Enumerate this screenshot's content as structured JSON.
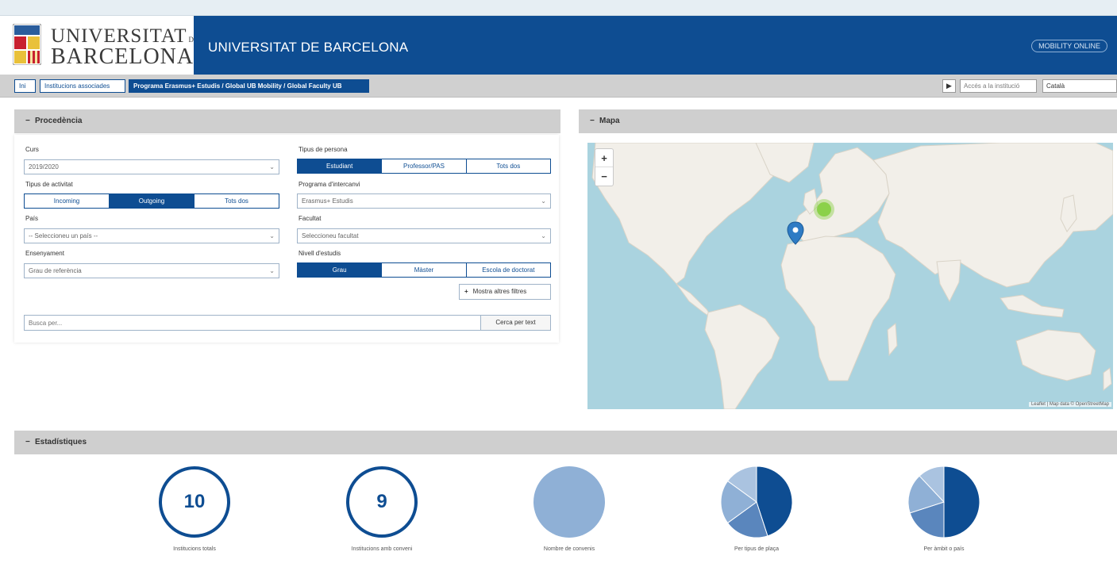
{
  "header": {
    "logo_line1": "UNIVERSITAT",
    "logo_line1_suffix": "DE",
    "logo_line2": "BARCELONA",
    "title": "UNIVERSITAT DE BARCELONA",
    "brand_badge": "MOBILITY ONLINE"
  },
  "breadcrumbs": [
    {
      "label": "Ini",
      "active": false
    },
    {
      "label": "Institucions associades",
      "active": false
    },
    {
      "label": "Programa Erasmus+ Estudis / Global UB Mobility / Global Faculty UB",
      "active": true
    }
  ],
  "nav_right": {
    "link": "Accés a la institució",
    "language": "Català"
  },
  "filters": {
    "panel_title": "Procedència",
    "curs": {
      "label": "Curs",
      "value": "2019/2020"
    },
    "tipus_persona": {
      "label": "Tipus de persona",
      "options": [
        "Estudiant",
        "Professor/PAS",
        "Tots dos"
      ],
      "selected": 0
    },
    "tipus_activitat": {
      "label": "Tipus de activitat",
      "options": [
        "Incoming",
        "Outgoing",
        "Tots dos"
      ],
      "selected": 1
    },
    "programa": {
      "label": "Programa d'intercanvi",
      "value": "Erasmus+ Estudis"
    },
    "pais": {
      "label": "País",
      "value": "-- Seleccioneu un país --"
    },
    "facultat": {
      "label": "Facultat",
      "value": "Seleccioneu facultat"
    },
    "ensenyament": {
      "label": "Ensenyament",
      "value": "Grau de referència"
    },
    "nivell": {
      "label": "Nivell d'estudis",
      "options": [
        "Grau",
        "Màster",
        "Escola de doctorat"
      ],
      "selected": 0
    },
    "more_filters": "Mostra altres filtres",
    "search_placeholder": "Busca per...",
    "search_button": "Cerca per text"
  },
  "map": {
    "panel_title": "Mapa",
    "zoom_in": "+",
    "zoom_out": "−",
    "attribution": "Leaflet | Map data © OpenStreetMap"
  },
  "stats": {
    "panel_title": "Estadístiques",
    "items": [
      {
        "value": "10",
        "label": "Institucions totals"
      },
      {
        "value": "9",
        "label": "Institucions amb conveni"
      },
      {
        "value": "",
        "label": "Nombre de convenis"
      },
      {
        "value": "",
        "label": "Per tipus de plaça"
      },
      {
        "value": "",
        "label": "Per àmbit o país"
      }
    ]
  },
  "colors": {
    "brand_blue": "#0e4d92",
    "light_blue": "#8fb0d6",
    "mid_blue": "#5a86bd",
    "panel_gray": "#cfcfcf",
    "sea": "#aad3df",
    "land": "#f2efe9",
    "marker_green": "#8bd14a"
  },
  "chart_data": [
    {
      "type": "pie",
      "title": "",
      "slices": [
        {
          "label": "",
          "value": 1
        }
      ]
    },
    {
      "type": "pie",
      "title": "",
      "slices": [
        {
          "label": "",
          "value": 0.45
        },
        {
          "label": "",
          "value": 0.2
        },
        {
          "label": "",
          "value": 0.2
        },
        {
          "label": "",
          "value": 0.15
        }
      ]
    },
    {
      "type": "pie",
      "title": "",
      "slices": [
        {
          "label": "",
          "value": 0.5
        },
        {
          "label": "",
          "value": 0.2
        },
        {
          "label": "",
          "value": 0.18
        },
        {
          "label": "",
          "value": 0.12
        }
      ]
    }
  ]
}
